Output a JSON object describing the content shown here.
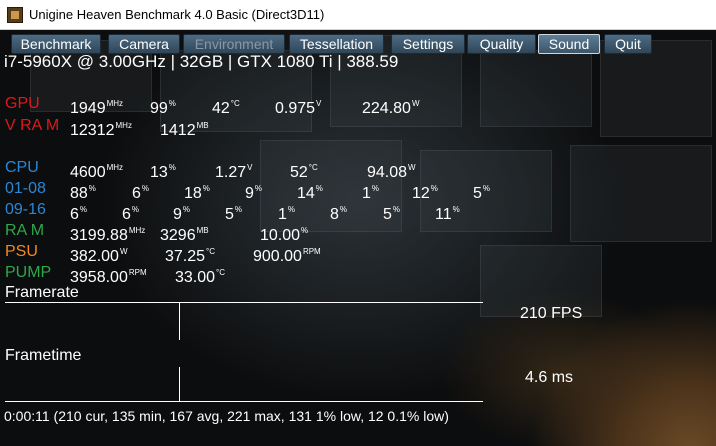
{
  "window": {
    "title": "Unigine Heaven Benchmark 4.0 Basic (Direct3D11)",
    "icon": "unigine-app-icon"
  },
  "menu": [
    {
      "label": "Benchmark",
      "state": "normal"
    },
    {
      "label": "Camera",
      "state": "normal"
    },
    {
      "label": "Environment",
      "state": "disabled"
    },
    {
      "label": "Tessellation",
      "state": "normal"
    },
    {
      "label": "Settings",
      "state": "normal"
    },
    {
      "label": "Quality",
      "state": "normal"
    },
    {
      "label": "Sound",
      "state": "active"
    },
    {
      "label": "Quit",
      "state": "normal"
    }
  ],
  "system_line": "i7-5960X @ 3.00GHz | 32GB | GTX 1080 Ti | 388.59",
  "rows": [
    {
      "label": "GPU",
      "color": "#e01818",
      "cells": [
        {
          "v": "1949",
          "u": "MHz"
        },
        {
          "v": "99",
          "u": "%"
        },
        {
          "v": "42",
          "u": "°C"
        },
        {
          "v": "0.975",
          "u": "V"
        },
        {
          "v": "224.80",
          "u": "W"
        }
      ]
    },
    {
      "label": "V RA M",
      "color": "#e01818",
      "cells": [
        {
          "v": "12312",
          "u": "MHz"
        },
        {
          "v": "1412",
          "u": "MB"
        }
      ]
    },
    {
      "label": "CPU",
      "color": "#2a86d6",
      "cells": [
        {
          "v": "4600",
          "u": "MHz"
        },
        {
          "v": "13",
          "u": "%"
        },
        {
          "v": "1.27",
          "u": "V"
        },
        {
          "v": "52",
          "u": "°C"
        },
        {
          "v": "94.08",
          "u": "W"
        }
      ]
    },
    {
      "label": "01-08",
      "color": "#2a86d6",
      "cells": [
        {
          "v": "88",
          "u": "%"
        },
        {
          "v": "6",
          "u": "%"
        },
        {
          "v": "18",
          "u": "%"
        },
        {
          "v": "9",
          "u": "%"
        },
        {
          "v": "14",
          "u": "%"
        },
        {
          "v": "1",
          "u": "%"
        },
        {
          "v": "12",
          "u": "%"
        },
        {
          "v": "5",
          "u": "%"
        }
      ]
    },
    {
      "label": "09-16",
      "color": "#2a86d6",
      "cells": [
        {
          "v": "6",
          "u": "%"
        },
        {
          "v": "6",
          "u": "%"
        },
        {
          "v": "9",
          "u": "%"
        },
        {
          "v": "5",
          "u": "%"
        },
        {
          "v": "1",
          "u": "%"
        },
        {
          "v": "8",
          "u": "%"
        },
        {
          "v": "5",
          "u": "%"
        },
        {
          "v": "11",
          "u": "%"
        }
      ]
    },
    {
      "label": "RA M",
      "color": "#2ea84a",
      "cells": [
        {
          "v": "3199.88",
          "u": "MHz"
        },
        {
          "v": "3296",
          "u": "MB"
        },
        {
          "v": "10.00",
          "u": "%"
        }
      ]
    },
    {
      "label": "PSU",
      "color": "#ef8a22",
      "cells": [
        {
          "v": "382.00",
          "u": "W"
        },
        {
          "v": "37.25",
          "u": "°C"
        },
        {
          "v": "900.00",
          "u": "RPM"
        }
      ]
    },
    {
      "label": "PUMP",
      "color": "#2ea84a",
      "cells": [
        {
          "v": "3958.00",
          "u": "RPM"
        },
        {
          "v": "33.00",
          "u": "°C"
        }
      ]
    }
  ],
  "graphs": {
    "framerate": {
      "label": "Framerate",
      "value": "210 FPS"
    },
    "frametime": {
      "label": "Frametime",
      "value": "4.6 ms"
    }
  },
  "status_line": "0:00:11 (210 cur, 135 min, 167 avg, 221 max, 131 1% low, 12 0.1% low)"
}
